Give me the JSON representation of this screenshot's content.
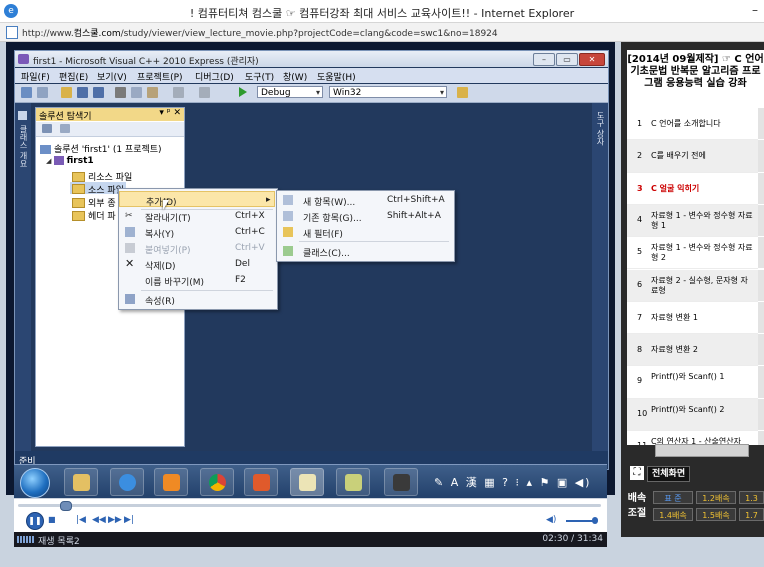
{
  "browser": {
    "title": "! 컴퓨터티쳐 컴스쿨 ☞ 컴퓨터강좌 최대 서비스 교육사이트!! - Internet Explorer",
    "url_prefix": "http://www.",
    "url_domain": "컴스쿨.com",
    "url_path": "/study/viewer/view_lecture_movie.php?projectCode=clang&code=swc1&no=18924"
  },
  "vs": {
    "title": "first1 - Microsoft Visual C++ 2010 Express (관리자)",
    "menu": [
      "파일(F)",
      "편집(E)",
      "보기(V)",
      "프로젝트(P)",
      "디버그(D)",
      "도구(T)",
      "창(W)",
      "도움말(H)"
    ],
    "config": "Debug",
    "platform": "Win32",
    "left_strip": "클래스 개요",
    "right_strip": "도구 상자",
    "status": "준비"
  },
  "solution_explorer": {
    "title": "솔루션 탐색기",
    "controls": "▾ ᵖ ✕",
    "solution": "솔루션 'first1' (1 프로젝트)",
    "project": "first1",
    "folders": [
      "리소스 파일",
      "소스 파일",
      "외부 종",
      "헤더 파"
    ]
  },
  "context_menu": {
    "items": [
      {
        "label": "추가(D)",
        "shortcut": "",
        "disabled": false
      },
      {
        "label": "잘라내기(T)",
        "shortcut": "Ctrl+X",
        "disabled": false
      },
      {
        "label": "복사(Y)",
        "shortcut": "Ctrl+C",
        "disabled": false
      },
      {
        "label": "붙여넣기(P)",
        "shortcut": "Ctrl+V",
        "disabled": true
      },
      {
        "label": "삭제(D)",
        "shortcut": "Del",
        "disabled": false
      },
      {
        "label": "이름 바꾸기(M)",
        "shortcut": "F2",
        "disabled": false
      },
      {
        "label": "속성(R)",
        "shortcut": "",
        "disabled": false
      }
    ]
  },
  "submenu": {
    "items": [
      {
        "label": "새 항목(W)...",
        "shortcut": "Ctrl+Shift+A"
      },
      {
        "label": "기존 항목(G)...",
        "shortcut": "Shift+Alt+A"
      },
      {
        "label": "새 필터(F)",
        "shortcut": ""
      },
      {
        "label": "클래스(C)...",
        "shortcut": ""
      }
    ]
  },
  "taskbar": {
    "tray": "✎ A 漢 ▦ ? ⁝ ▴ ⚑ ▣ ◀)"
  },
  "player": {
    "playlist_label": "재생 목록2",
    "time": "02:30 / 31:34",
    "progress": 0.08,
    "volume": 0.85
  },
  "lecture": {
    "title": "[2014년 09월제작] ☞ C 언어 기초문법 반복문 알고리즘 프로그램 응용능력 실습 강좌",
    "current_index": 3,
    "items": [
      {
        "no": "1",
        "title": "C 언어를 소개합니다"
      },
      {
        "no": "2",
        "title": "C를 배우기 전에"
      },
      {
        "no": "3",
        "title": "C 얼굴 익히기"
      },
      {
        "no": "4",
        "title": "자료형 1 - 변수와 정수형 자료형 1"
      },
      {
        "no": "5",
        "title": "자료형 1 - 변수와 정수형 자료형 2"
      },
      {
        "no": "6",
        "title": "자료형 2 - 실수형, 문자형 자료형"
      },
      {
        "no": "7",
        "title": "자료형 변환 1"
      },
      {
        "no": "8",
        "title": "자료형 변환 2"
      },
      {
        "no": "9",
        "title": "Printf()와 Scanf() 1"
      },
      {
        "no": "10",
        "title": "Printf()와 Scanf() 2"
      },
      {
        "no": "11",
        "title": "C의 연산자 1 - 산술연산자"
      }
    ]
  },
  "fullscreen": {
    "label": "전체화면"
  },
  "speed": {
    "label": "배속 조절",
    "options": [
      "표 준",
      "1.2배속",
      "1.3",
      "1.4배속",
      "1.5배속",
      "1.7"
    ]
  },
  "colors": {
    "current_lecture": "#cc0000",
    "vs_background": "#22395d",
    "menu_highlight": "#fbe6a9"
  }
}
